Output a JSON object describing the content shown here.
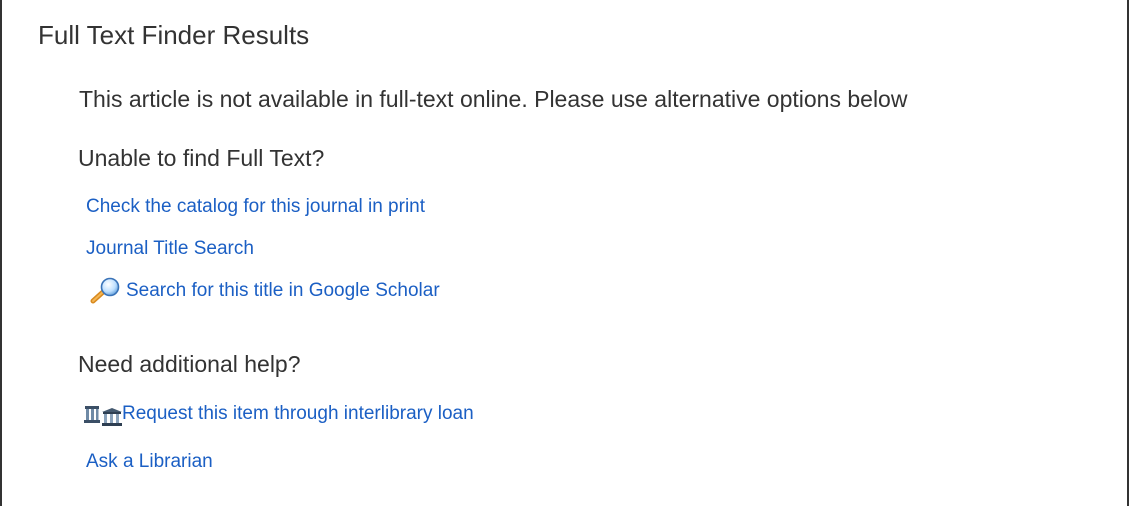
{
  "panel": {
    "title": "Full Text Finder Results",
    "notice": "This article is not available in full-text online. Please use alternative options below"
  },
  "sections": {
    "unable": {
      "heading": "Unable to find Full Text?",
      "links": {
        "catalog": "Check the catalog for this journal in print",
        "journal_title": "Journal Title Search",
        "google_scholar": "Search for this title in Google Scholar"
      }
    },
    "help": {
      "heading": "Need additional help?",
      "links": {
        "interlibrary": "Request this item through interlibrary loan",
        "librarian": "Ask a Librarian"
      }
    }
  },
  "icons": {
    "google_scholar": "magnifier-icon",
    "interlibrary": "library-building-icon"
  },
  "colors": {
    "text": "#333333",
    "link": "#1b5fc4"
  }
}
